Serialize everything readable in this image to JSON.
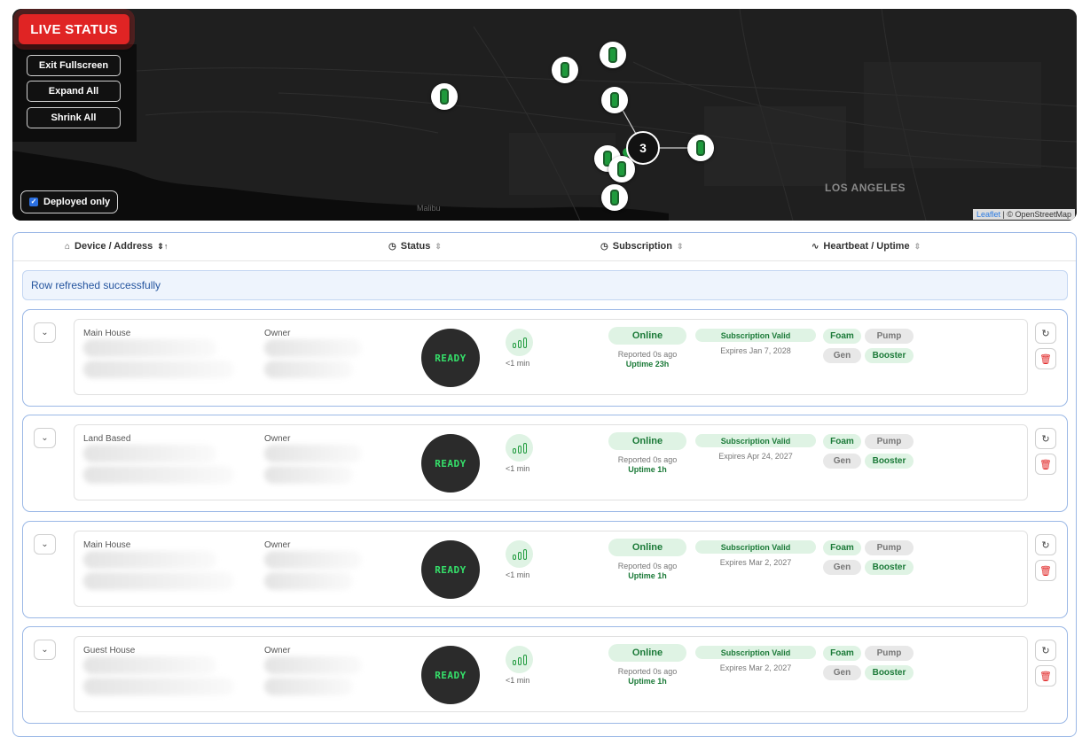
{
  "map": {
    "live_status": "LIVE STATUS",
    "exit_fullscreen": "Exit Fullscreen",
    "expand_all": "Expand All",
    "shrink_all": "Shrink All",
    "deployed_only": "Deployed only",
    "cluster_count": "3",
    "city_label": "LOS ANGELES",
    "area_label": "Malibu",
    "attribution_link": "Leaflet",
    "attribution_text": "| © OpenStreetMap"
  },
  "table": {
    "headers": {
      "device": "Device / Address",
      "status": "Status",
      "subscription": "Subscription",
      "heartbeat": "Heartbeat / Uptime"
    },
    "alert": "Row refreshed successfully",
    "owner_label": "Owner",
    "ready_label": "READY",
    "signal_text": "<1 min",
    "online_label": "Online",
    "sub_valid": "Subscription Valid",
    "tags": {
      "foam": "Foam",
      "pump": "Pump",
      "gen": "Gen",
      "booster": "Booster"
    },
    "rows": [
      {
        "name": "Main House",
        "reported": "Reported 0s ago",
        "uptime": "Uptime  23h",
        "expires": "Expires  Jan 7, 2028"
      },
      {
        "name": "Land Based",
        "reported": "Reported 0s ago",
        "uptime": "Uptime 1h",
        "expires": "Expires Apr 24, 2027"
      },
      {
        "name": "Main House",
        "reported": "Reported 0s ago",
        "uptime": "Uptime 1h",
        "expires": "Expires Mar 2, 2027"
      },
      {
        "name": "Guest House",
        "reported": "Reported 0s ago",
        "uptime": "Uptime 1h",
        "expires": "Expires Mar 2, 2027"
      }
    ]
  }
}
